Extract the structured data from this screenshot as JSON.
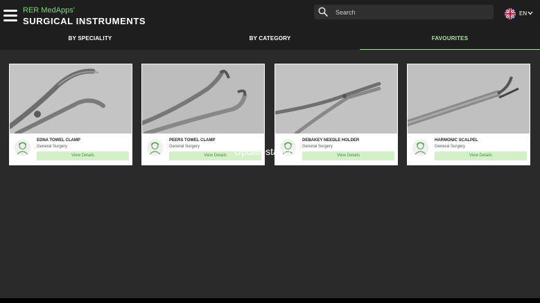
{
  "app": {
    "subtitle": "RER MedApps'",
    "title": "SURGICAL INSTRUMENTS"
  },
  "search": {
    "placeholder": "Search"
  },
  "language": {
    "code": "EN",
    "flag_icon": "uk-flag-icon"
  },
  "tabs": [
    {
      "label": "BY SPECIALITY",
      "active": false
    },
    {
      "label": "BY CATEGORY",
      "active": false
    },
    {
      "label": "FAVOURITES",
      "active": true
    }
  ],
  "cards": [
    {
      "title": "EDNA TOWEL CLAMP",
      "category": "General Surgery",
      "button": "View Details",
      "image_icon": "towel-clamp-image"
    },
    {
      "title": "PEERS TOWEL CLAMP",
      "category": "General Surgery",
      "button": "View Details",
      "image_icon": "towel-clamp-image"
    },
    {
      "title": "DEBAKEY NEEDLE HOLDER",
      "category": "General Surgery",
      "button": "View Details",
      "image_icon": "needle-holder-image"
    },
    {
      "title": "HARMONIC SCALPEL",
      "category": "General Surgery",
      "button": "View Details",
      "image_icon": "scalpel-image"
    }
  ],
  "watermark": "Updatestar.com",
  "colors": {
    "accent": "#a6e59a",
    "topbar": "#1e1e1e",
    "background": "#2b2a2a",
    "button_bg": "#d4f0c8"
  }
}
